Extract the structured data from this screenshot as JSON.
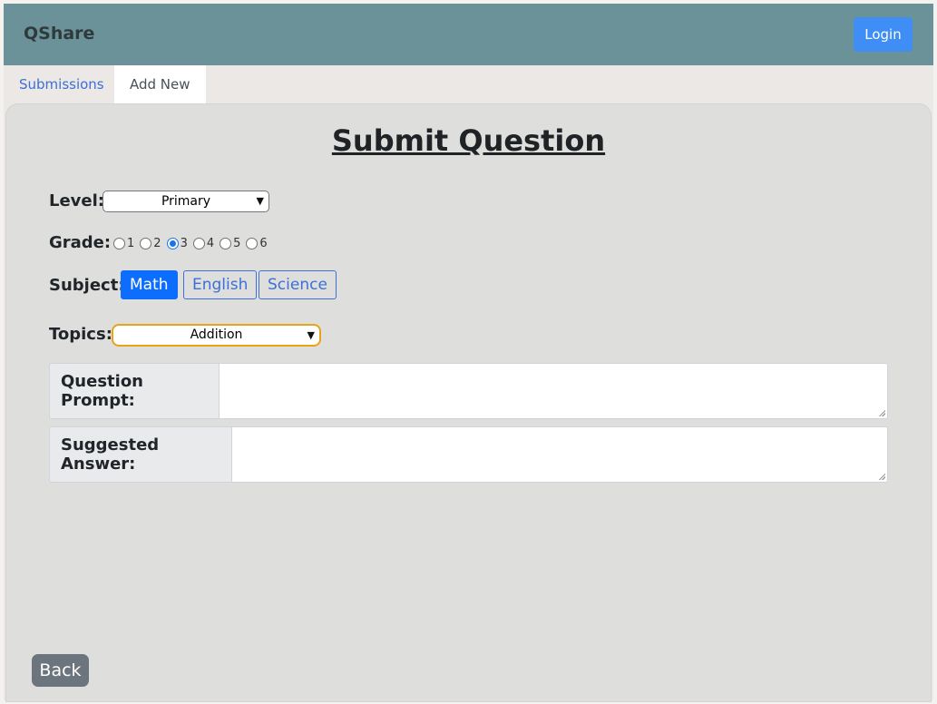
{
  "navbar": {
    "brand": "QShare",
    "login_label": "Login"
  },
  "tabs": [
    {
      "label": "Submissions",
      "active": false
    },
    {
      "label": "Add New",
      "active": true
    }
  ],
  "form": {
    "title": "Submit Question",
    "level": {
      "label": "Level:",
      "selected": "Primary"
    },
    "grade": {
      "label": "Grade:",
      "options": [
        "1",
        "2",
        "3",
        "4",
        "5",
        "6"
      ],
      "selected": "3"
    },
    "subject": {
      "label": "Subject:",
      "options": [
        "Math",
        "English",
        "Science"
      ],
      "selected": "Math"
    },
    "topics": {
      "label": "Topics:",
      "selected": "Addition"
    },
    "question_prompt": {
      "label": "Question Prompt:",
      "value": ""
    },
    "suggested_answer": {
      "label": "Suggested Answer:",
      "value": ""
    }
  },
  "back_label": "Back",
  "colors": {
    "navbar": "#6a9298",
    "primary": "#0d6efd",
    "login": "#3f8ef5",
    "back": "#6c757d",
    "topics_focus": "#e8a317"
  }
}
